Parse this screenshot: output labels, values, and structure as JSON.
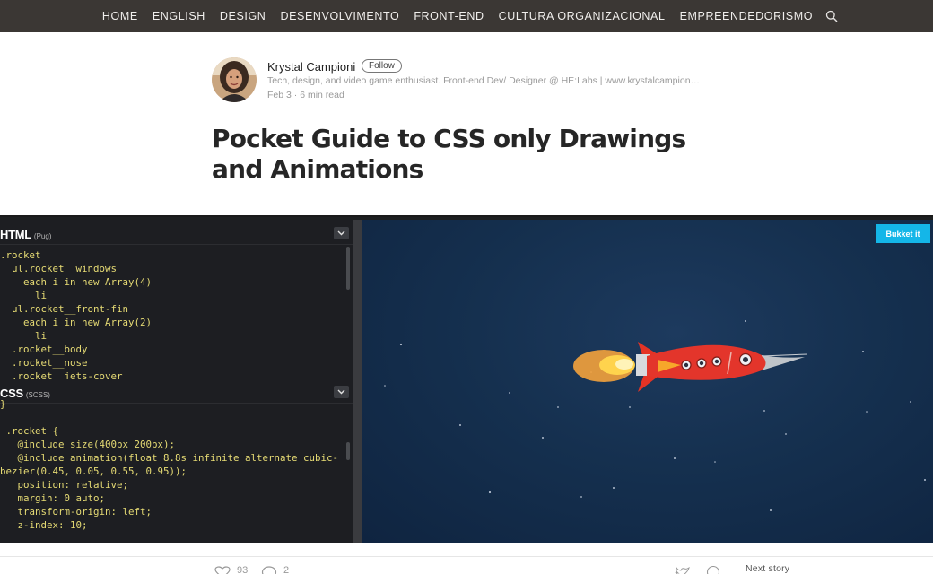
{
  "nav": {
    "items": [
      "HOME",
      "ENGLISH",
      "DESIGN",
      "DESENVOLVIMENTO",
      "FRONT-END",
      "CULTURA ORGANIZACIONAL",
      "EMPREENDEDORISMO"
    ],
    "search_icon": "search-icon"
  },
  "author": {
    "name": "Krystal Campioni",
    "follow_label": "Follow",
    "bio": "Tech, design, and video game enthusiast. Front-end Dev/ Designer @ HE:Labs | www.krystalcampion…",
    "date": "Feb 3",
    "read_time": "6 min read"
  },
  "article": {
    "title": "Pocket Guide to CSS only Drawings and Animations"
  },
  "embed": {
    "html_pane": {
      "lang": "HTML",
      "preprocessor": "(Pug)"
    },
    "css_pane": {
      "lang": "CSS",
      "preprocessor": "(SCSS)"
    },
    "html_code": [
      ".rocket",
      "  ul.rocket__windows",
      "    each i in new Array(4)",
      "      li",
      "  ul.rocket__front-fin",
      "    each i in new Array(2)",
      "      li",
      "  .rocket__body",
      "  .rocket__nose",
      "  .rocket__jets-cover"
    ],
    "css_code": [
      "}",
      "",
      " .rocket {",
      "   @include size(400px 200px);",
      "   @include animation(float 8.8s infinite alternate cubic-",
      "bezier(0.45, 0.05, 0.55, 0.95));",
      "   position: relative;",
      "   margin: 0 auto;",
      "   transform-origin: left;",
      "   z-index: 10;"
    ],
    "bukket_label": "Bukket it"
  },
  "footer": {
    "claps": "93",
    "responses": "2",
    "next_story_label": "Next story"
  }
}
